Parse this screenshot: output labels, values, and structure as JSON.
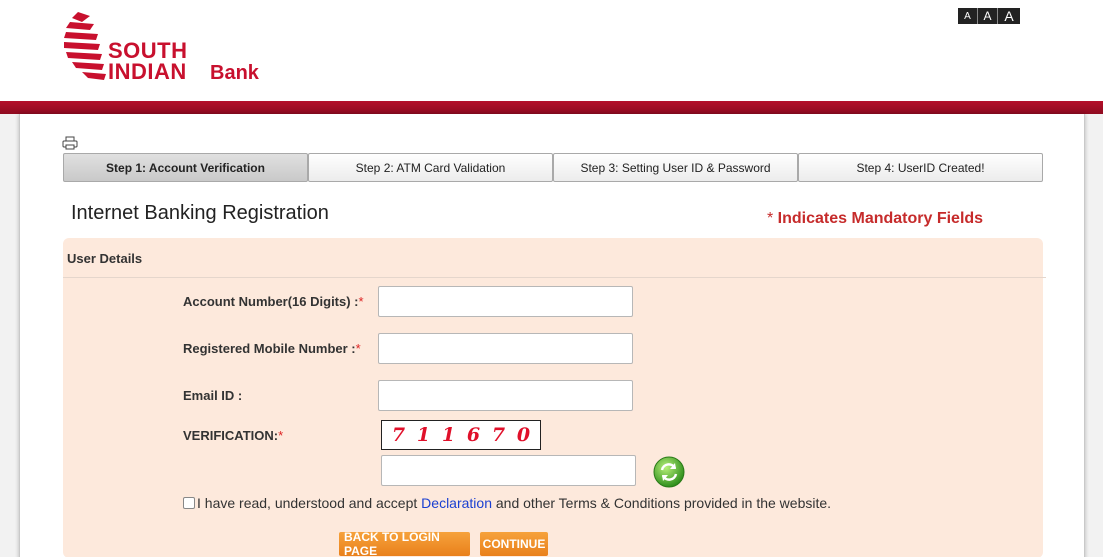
{
  "header": {
    "logo_line1": "SOUTH",
    "logo_line2": "INDIAN",
    "logo_line3": "Bank",
    "font_size_options": [
      "A",
      "A",
      "A"
    ]
  },
  "steps": [
    {
      "label": "Step 1: Account Verification",
      "active": true
    },
    {
      "label": "Step 2: ATM Card Validation",
      "active": false
    },
    {
      "label": "Step 3: Setting User ID & Password",
      "active": false
    },
    {
      "label": "Step 4: UserID Created!",
      "active": false
    }
  ],
  "page": {
    "title": "Internet Banking Registration",
    "mandatory_star": "*",
    "mandatory_text": " Indicates Mandatory Fields"
  },
  "form": {
    "section_title": "User Details",
    "account_label": "Account Number(16 Digits) :",
    "mobile_label": "Registered Mobile Number :",
    "email_label": "Email ID :",
    "verification_label": "VERIFICATION:",
    "required_mark": "*",
    "account_value": "",
    "mobile_value": "",
    "email_value": "",
    "captcha_input_value": "",
    "captcha_digits": [
      "7",
      "1",
      "1",
      "6",
      "7",
      "0"
    ],
    "agree_prefix": "I have read, understood and accept ",
    "agree_link": "Declaration",
    "agree_suffix": " and other Terms & Conditions provided in the website."
  },
  "buttons": {
    "back": "BACK TO LOGIN PAGE",
    "continue": "CONTINUE"
  },
  "colors": {
    "brand_red": "#c8102e",
    "form_bg": "#fde9dc",
    "button_orange": "#ee8a25",
    "link_blue": "#1a3fd1"
  }
}
